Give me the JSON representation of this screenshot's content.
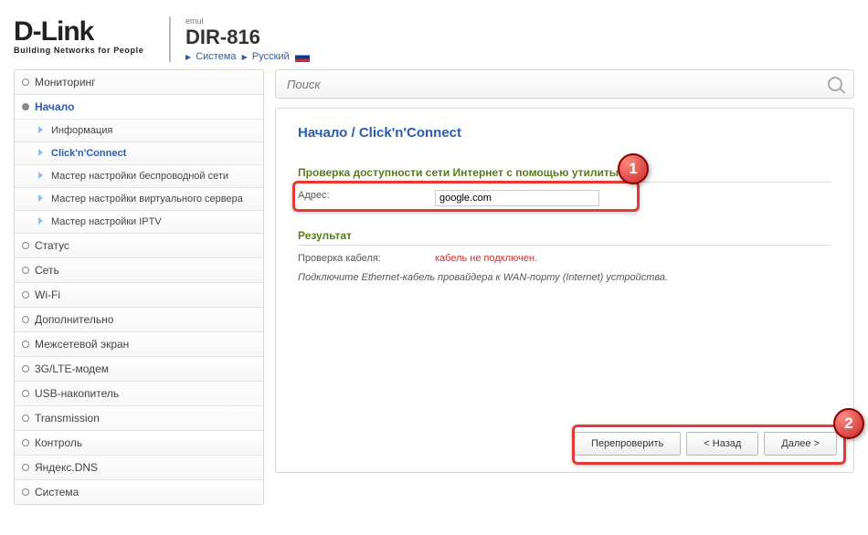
{
  "brand": {
    "name": "D-Link",
    "tag": "Building Networks for People"
  },
  "header": {
    "sup": "emul",
    "model": "DIR-816",
    "links": [
      "Система",
      "Русский"
    ]
  },
  "search": {
    "placeholder": "Поиск"
  },
  "sidebar": {
    "monitoring": "Мониторинг",
    "start": "Начало",
    "start_items": [
      "Информация",
      "Click'n'Connect",
      "Мастер настройки беспроводной сети",
      "Мастер настройки виртуального сервера",
      "Мастер настройки IPTV"
    ],
    "rest": [
      "Статус",
      "Сеть",
      "Wi-Fi",
      "Дополнительно",
      "Межсетевой экран",
      "3G/LTE-модем",
      "USB-накопитель",
      "Transmission",
      "Контроль",
      "Яндекс.DNS",
      "Система"
    ]
  },
  "breadcrumb": "Начало /  Click'n'Connect",
  "section1": {
    "title": "Проверка доступности сети Интернет с помощью утилиты Ping",
    "addr_label": "Адрес:",
    "addr_value": "google.com"
  },
  "section2": {
    "title": "Результат",
    "check_label": "Проверка кабеля:",
    "check_value": "кабель не подключен.",
    "hint": "Подключите Ethernet-кабель провайдера к WAN-порту (Internet) устройства."
  },
  "buttons": {
    "recheck": "Перепроверить",
    "back": "< Назад",
    "next": "Далее >"
  },
  "ann": {
    "one": "1",
    "two": "2"
  }
}
